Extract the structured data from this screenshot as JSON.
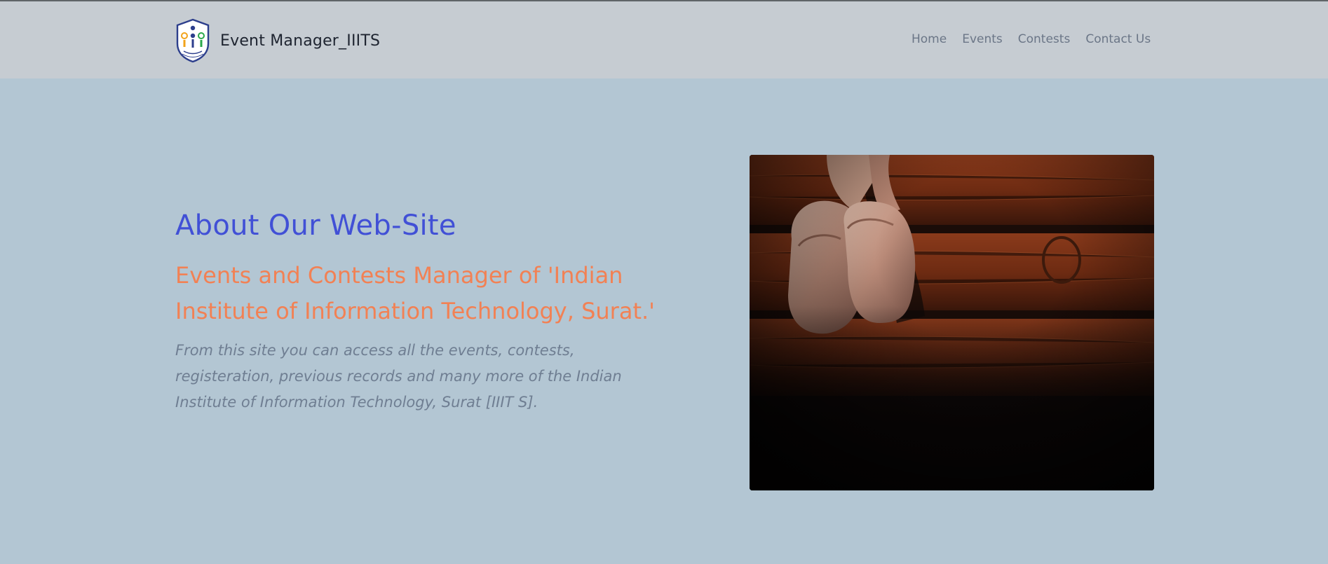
{
  "header": {
    "brand_name": "Event Manager_IIITS",
    "logo_icon": "iiit-surat-crest-icon"
  },
  "nav": {
    "items": [
      {
        "label": "Home"
      },
      {
        "label": "Events"
      },
      {
        "label": "Contests"
      },
      {
        "label": "Contact Us"
      }
    ]
  },
  "hero": {
    "title": "About Our Web-Site",
    "subtitle": "Events and Contests Manager of 'Indian Institute of Information Technology, Surat.'",
    "description": "From this site you can access all the events, contests, registeration, previous records and many more of the Indian Institute of Information Technology, Surat [IIIT S].",
    "image_subject": "ballet-shoes-photo"
  },
  "colors": {
    "page_background": "#b3c6d3",
    "header_background": "#c6ccd2",
    "title": "#4150d6",
    "subtitle": "#f28154",
    "description": "#6f7e92"
  }
}
